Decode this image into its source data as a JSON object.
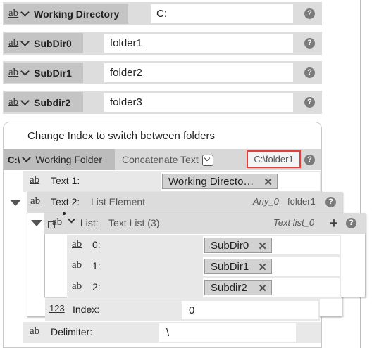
{
  "params": [
    {
      "type": "ab",
      "label": "Working Directory",
      "value": "C:"
    },
    {
      "type": "ab",
      "label": "SubDir0",
      "value": "folder1"
    },
    {
      "type": "ab",
      "label": "SubDir1",
      "value": "folder2"
    },
    {
      "type": "ab",
      "label": "Subdir2",
      "value": "folder3"
    }
  ],
  "help_glyph": "?",
  "info_text": "Change Index to switch between folders",
  "working_folder": {
    "type": "C:\\",
    "label": "Working Folder",
    "mode": "Concatenate Text",
    "result": "C:\\folder1"
  },
  "text1": {
    "type": "ab",
    "label": "Text 1:",
    "chip": "Working Directo…"
  },
  "text2": {
    "type": "ab",
    "label": "Text 2:",
    "kind": "List Element",
    "name": "Any_0",
    "value": "folder1"
  },
  "list": {
    "type": "ab",
    "label": "List:",
    "kind": "Text List (3)",
    "name": "Text list_0",
    "plus": "+"
  },
  "list_items": [
    {
      "type": "ab",
      "index": "0:",
      "chip": "SubDir0"
    },
    {
      "type": "ab",
      "index": "1:",
      "chip": "SubDir1"
    },
    {
      "type": "ab",
      "index": "2:",
      "chip": "Subdir2"
    }
  ],
  "index": {
    "type": "123",
    "label": "Index:",
    "value": "0"
  },
  "delimiter": {
    "type": "ab",
    "label": "Delimiter:",
    "value": "\\"
  },
  "x_glyph": "✕"
}
